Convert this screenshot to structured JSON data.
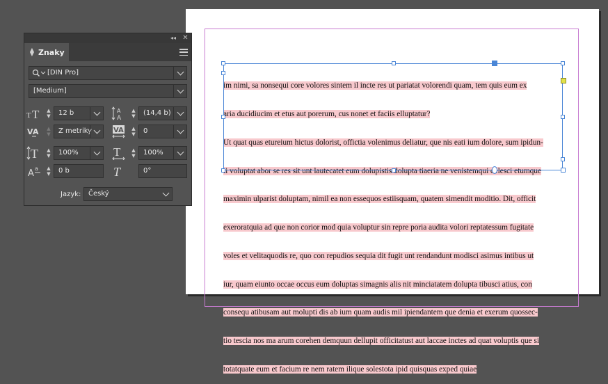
{
  "panel": {
    "title": "Znaky",
    "font_family": "[DIN Pro]",
    "font_style": "[Medium]",
    "font_size": "12 b",
    "leading": "(14,4 b)",
    "kerning": "Z metriky",
    "tracking": "0",
    "vertical_scale": "100%",
    "horizontal_scale": "100%",
    "baseline_shift": "0 b",
    "skew": "0°",
    "language_label": "Jazyk:",
    "language": "Český"
  },
  "document": {
    "lines": [
      "im nimi, sa nonsequi core volores sintem il incte res ut pariatat volorendi quam, tem quis eum ex",
      "aria ducidiucim et etus aut porerum, cus nonet et faciis elluptatur?",
      "Ut quat quas etureium hictus dolorist, offictia volenimus deliatur, que nis eati ium dolore, sum ipidun-",
      "ti voluptat abor se res sit unt lautecatet eum dolupistis dolupta tiaeria ne venistemqui delesci etumque",
      "maximin ulparist doluptam, nimil ea non essequos estiisquam, quatem simendit moditio. Dit, officit",
      "exeroratquia ad que non corior mod quia voluptur sin repre poria audita volori reptatessum fugitate",
      "voles et velitaquodis re, quo con repudios sequia dit fugit unt rendandunt modisci asimus intibus ut",
      "iur, quam eiunto occae occus eum doluptas simagnis alis nit minciatatem dolupta tibusci atius, con",
      "consequ atibusam aut molupti dis ab ium quam audis mil ipiendantem que denia et exerum quossec-",
      "tio tescia nos ma arum corehen demquun dellupit officitatust aut laccae inctes ad quat voluptis que si",
      "totatquate eum et facium re nem ratem ilique solestota ipid quisquas exped quiae"
    ]
  },
  "colors": {
    "workspace": "#535353",
    "selection_highlight": "#f8c9cd",
    "frame_border": "#4a86d6",
    "margin_guide": "#c77bd1"
  },
  "icons": {
    "search": "search-icon",
    "font_size": "font-size-icon",
    "leading": "leading-icon",
    "kerning": "kerning-icon",
    "tracking": "tracking-icon",
    "vertical_scale": "vertical-scale-icon",
    "horizontal_scale": "horizontal-scale-icon",
    "baseline_shift": "baseline-shift-icon",
    "skew": "skew-icon"
  }
}
